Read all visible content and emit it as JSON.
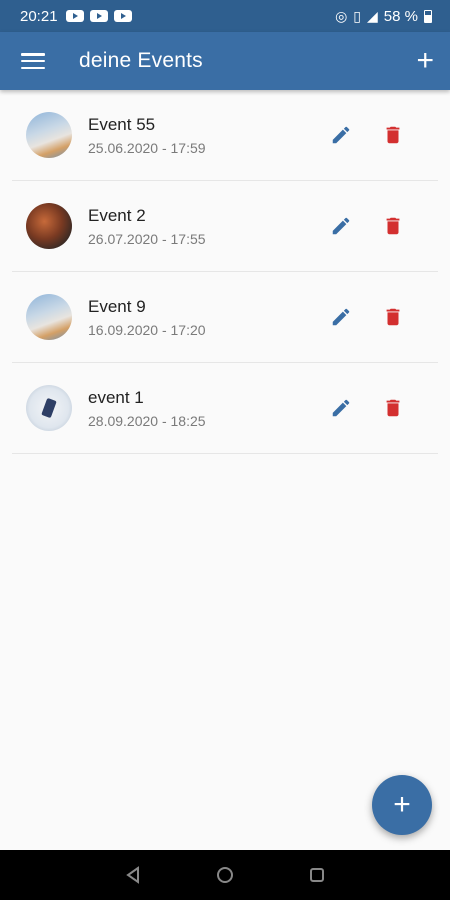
{
  "status_bar": {
    "time": "20:21",
    "battery": "58 %"
  },
  "app_bar": {
    "title": "deine Events",
    "add_symbol": "+"
  },
  "events": [
    {
      "title": "Event 55",
      "date": "25.06.2020 - 17:59",
      "avatar": "snow"
    },
    {
      "title": "Event 2",
      "date": "26.07.2020 - 17:55",
      "avatar": "fire"
    },
    {
      "title": "Event 9",
      "date": "16.09.2020 - 17:20",
      "avatar": "snow"
    },
    {
      "title": "event 1",
      "date": "28.09.2020 - 18:25",
      "avatar": "ski"
    }
  ],
  "fab": {
    "symbol": "+"
  },
  "colors": {
    "primary": "#3a6ea5",
    "status_bar": "#2f5f8f",
    "edit": "#3a6ea5",
    "delete": "#d32f2f"
  }
}
